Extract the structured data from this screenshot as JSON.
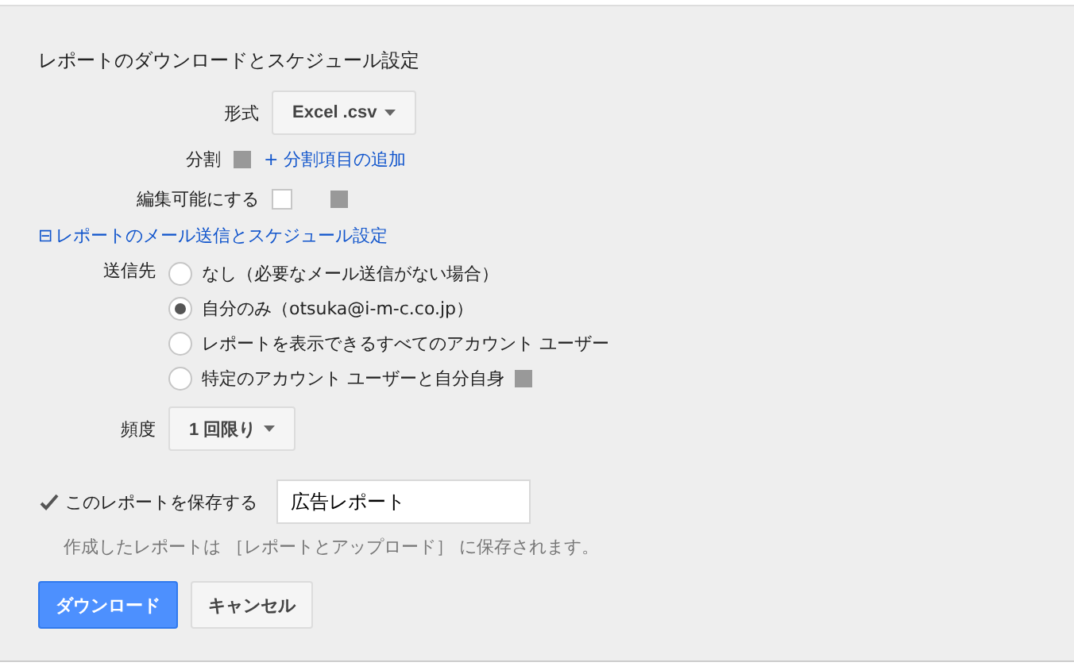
{
  "title": "レポートのダウンロードとスケジュール設定",
  "format": {
    "label": "形式",
    "value": "Excel .csv"
  },
  "segment": {
    "label": "分割",
    "link": "+ 分割項目の追加"
  },
  "editable": {
    "label": "編集可能にする",
    "checked": false
  },
  "email_section": {
    "toggle": "⊟",
    "label": "レポートのメール送信とスケジュール設定"
  },
  "recipients": {
    "label": "送信先",
    "options": [
      {
        "label": "なし（必要なメール送信がない場合）",
        "selected": false,
        "help": false
      },
      {
        "label": "自分のみ（otsuka@i-m-c.co.jp）",
        "selected": true,
        "help": false
      },
      {
        "label": "レポートを表示できるすべてのアカウント ユーザー",
        "selected": false,
        "help": false
      },
      {
        "label": "特定のアカウント ユーザーと自分自身",
        "selected": false,
        "help": true
      }
    ]
  },
  "frequency": {
    "label": "頻度",
    "value": "1 回限り"
  },
  "save": {
    "label": "このレポートを保存する",
    "checked": true,
    "value": "広告レポート",
    "hint": "作成したレポートは ［レポートとアップロード］ に保存されます。"
  },
  "buttons": [
    {
      "label": "ダウンロード",
      "kind": "primary"
    },
    {
      "label": "キャンセル",
      "kind": "secondary"
    }
  ]
}
